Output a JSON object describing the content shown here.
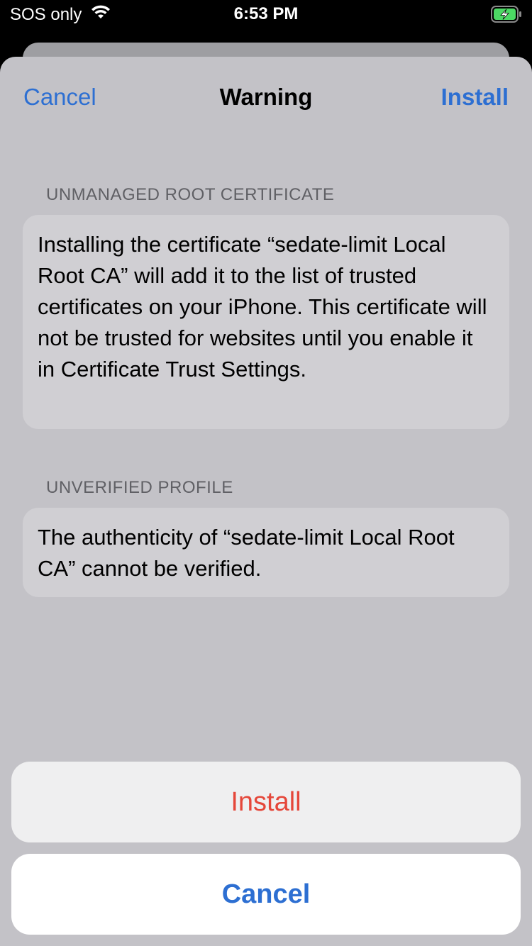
{
  "status_bar": {
    "carrier": "SOS only",
    "time": "6:53 PM",
    "wifi_icon": "wifi-icon",
    "battery_icon": "battery-charging-icon"
  },
  "nav": {
    "cancel_label": "Cancel",
    "title": "Warning",
    "install_label": "Install"
  },
  "sections": [
    {
      "header": "UNMANAGED ROOT CERTIFICATE",
      "body": "Installing the certificate “sedate-limit Local Root CA” will add it to the list of trusted certificates on your iPhone. This certificate will not be trusted for websites until you enable it in Certificate Trust Settings."
    },
    {
      "header": "UNVERIFIED PROFILE",
      "body": "The authenticity of “sedate-limit Local Root CA” cannot be verified."
    }
  ],
  "action_sheet": {
    "install_label": "Install",
    "cancel_label": "Cancel"
  },
  "colors": {
    "link_blue": "#2d6fd2",
    "destructive_red": "#e5473a",
    "sheet_bg": "#c3c2c7",
    "battery_green": "#4cd964"
  }
}
